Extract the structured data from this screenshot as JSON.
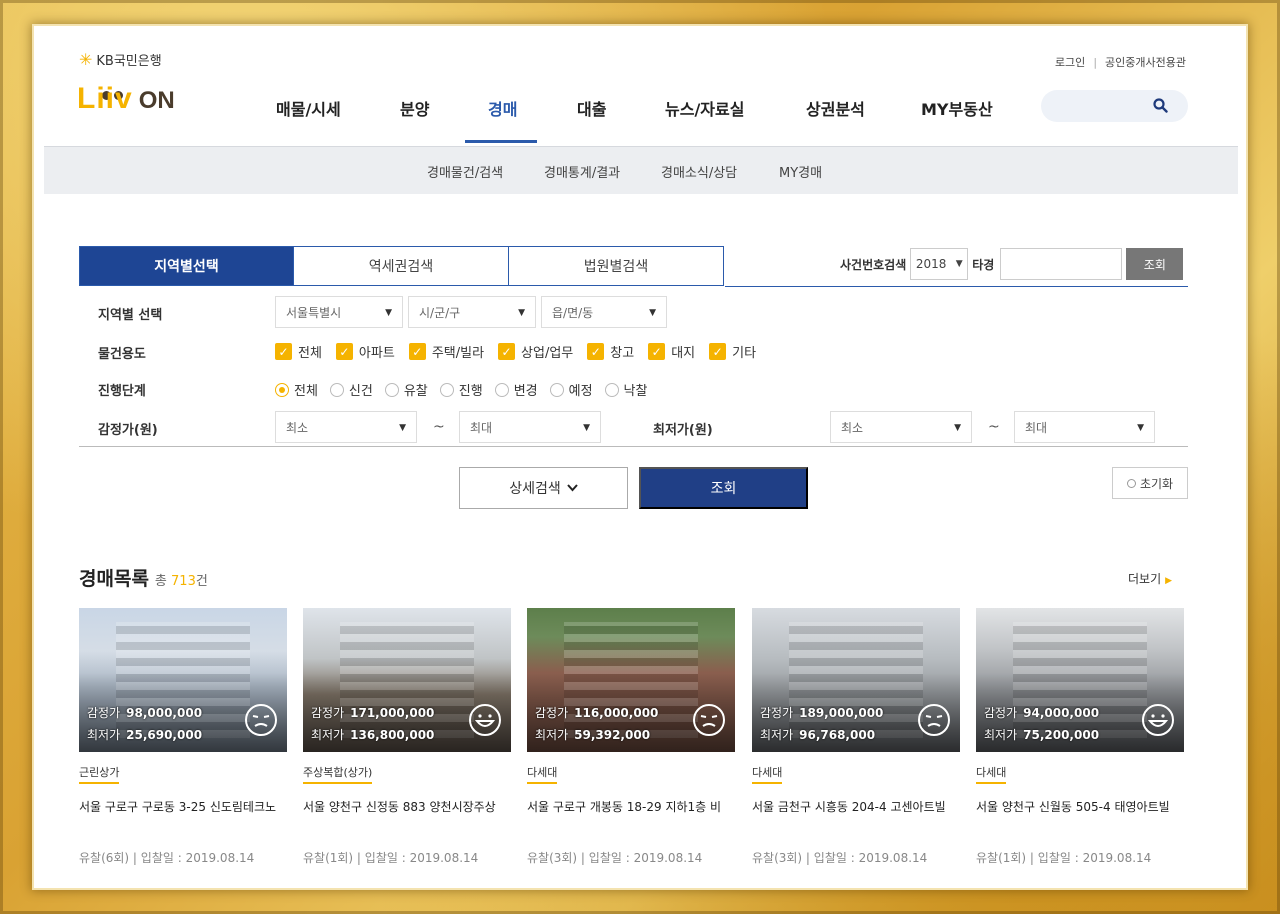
{
  "header": {
    "kb_brand": "KB국민은행",
    "logo_main": "Liiv",
    "logo_sub": "ON",
    "util_links": [
      "로그인",
      "공인중개사전용관"
    ],
    "search_icon": "search-icon"
  },
  "gnb": [
    "매물/시세",
    "분양",
    "경매",
    "대출",
    "뉴스/자료실",
    "상권분석",
    "MY부동산"
  ],
  "gnb_active": "경매",
  "lnb": [
    "경매물건/검색",
    "경매통계/결과",
    "경매소식/상담",
    "MY경매"
  ],
  "tabs": [
    "지역별선택",
    "역세권검색",
    "법원별검색"
  ],
  "case_search": {
    "label": "사건번호검색",
    "year": "2018",
    "type_label": "타경",
    "button": "조회"
  },
  "filters": {
    "region_label": "지역별 선택",
    "region_selects": [
      "서울특별시",
      "시/군/구",
      "읍/면/동"
    ],
    "usage_label": "물건용도",
    "usage_options": [
      "전체",
      "아파트",
      "주택/빌라",
      "상업/업무",
      "창고",
      "대지",
      "기타"
    ],
    "stage_label": "진행단계",
    "stage_options": [
      "전체",
      "신건",
      "유찰",
      "진행",
      "변경",
      "예정",
      "낙찰"
    ],
    "appraisal_label": "감정가(원)",
    "appraisal_min": "최소",
    "appraisal_max": "최대",
    "tilde": "~",
    "lowest_label": "최저가(원)",
    "lowest_min": "최소",
    "lowest_max": "최대"
  },
  "buttons": {
    "detail": "상세검색",
    "search": "조회",
    "reset": "초기화"
  },
  "list": {
    "title": "경매목록",
    "total_prefix": "총",
    "total_count": "713",
    "total_suffix": "건",
    "more": "더보기",
    "price_labels": {
      "appraisal": "감정가",
      "lowest": "최저가"
    },
    "items": [
      {
        "appraisal": "98,000,000",
        "lowest": "25,690,000",
        "category": "근린상가",
        "address": "서울 구로구 구로동 3-25 신도림테크노",
        "meta": "유찰(6회) | 입찰일 : 2019.08.14",
        "face": "sad"
      },
      {
        "appraisal": "171,000,000",
        "lowest": "136,800,000",
        "category": "주상복합(상가)",
        "address": "서울 양천구 신정동 883 양천시장주상",
        "meta": "유찰(1회) | 입찰일 : 2019.08.14",
        "face": "happy"
      },
      {
        "appraisal": "116,000,000",
        "lowest": "59,392,000",
        "category": "다세대",
        "address": "서울 구로구 개봉동 18-29 지하1층 비",
        "meta": "유찰(3회) | 입찰일 : 2019.08.14",
        "face": "sad"
      },
      {
        "appraisal": "189,000,000",
        "lowest": "96,768,000",
        "category": "다세대",
        "address": "서울 금천구 시흥동 204-4 고센아트빌",
        "meta": "유찰(3회) | 입찰일 : 2019.08.14",
        "face": "sad"
      },
      {
        "appraisal": "94,000,000",
        "lowest": "75,200,000",
        "category": "다세대",
        "address": "서울 양천구 신월동 505-4 태영아트빌",
        "meta": "유찰(1회) | 입찰일 : 2019.08.14",
        "face": "happy"
      }
    ]
  },
  "colors": {
    "accent": "#f5b300",
    "primary": "#1e4594",
    "active": "#2b5aab"
  }
}
